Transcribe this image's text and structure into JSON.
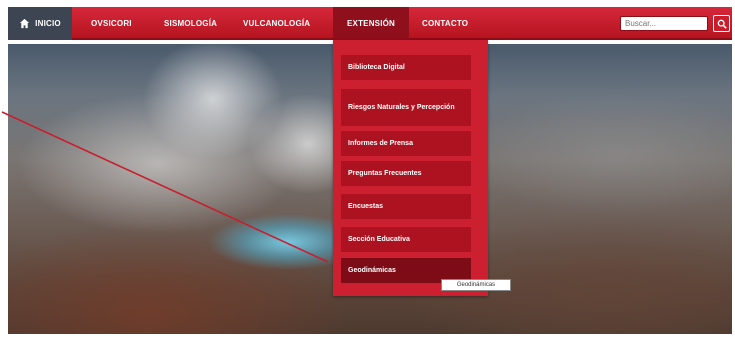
{
  "nav": {
    "home_label": "INICIO",
    "items": [
      {
        "label": "OVSICORI"
      },
      {
        "label": "SISMOLOGÍA"
      },
      {
        "label": "VULCANOLOGÍA"
      },
      {
        "label": "EXTENSIÓN"
      },
      {
        "label": "CONTACTO"
      }
    ],
    "search_placeholder": "Buscar...",
    "home_icon": "home-icon",
    "search_icon": "magnifier-icon"
  },
  "dropdown": {
    "items": [
      {
        "label": "Biblioteca Digital"
      },
      {
        "label": "Riesgos Naturales y Percepción"
      },
      {
        "label": "Informes de Prensa"
      },
      {
        "label": "Preguntas Frecuentes"
      },
      {
        "label": "Encuestas"
      },
      {
        "label": "Sección Educativa"
      },
      {
        "label": "Geodinámicas"
      }
    ]
  },
  "tooltip": "Geodinámicas",
  "colors": {
    "nav_red": "#c91d2c",
    "home_bg": "#3d4553",
    "menu_bg": "#cc1f30",
    "menu_item_bg": "#ad1220",
    "menu_item_hover": "#7e0c17",
    "annotation_line": "#c81e2e"
  }
}
